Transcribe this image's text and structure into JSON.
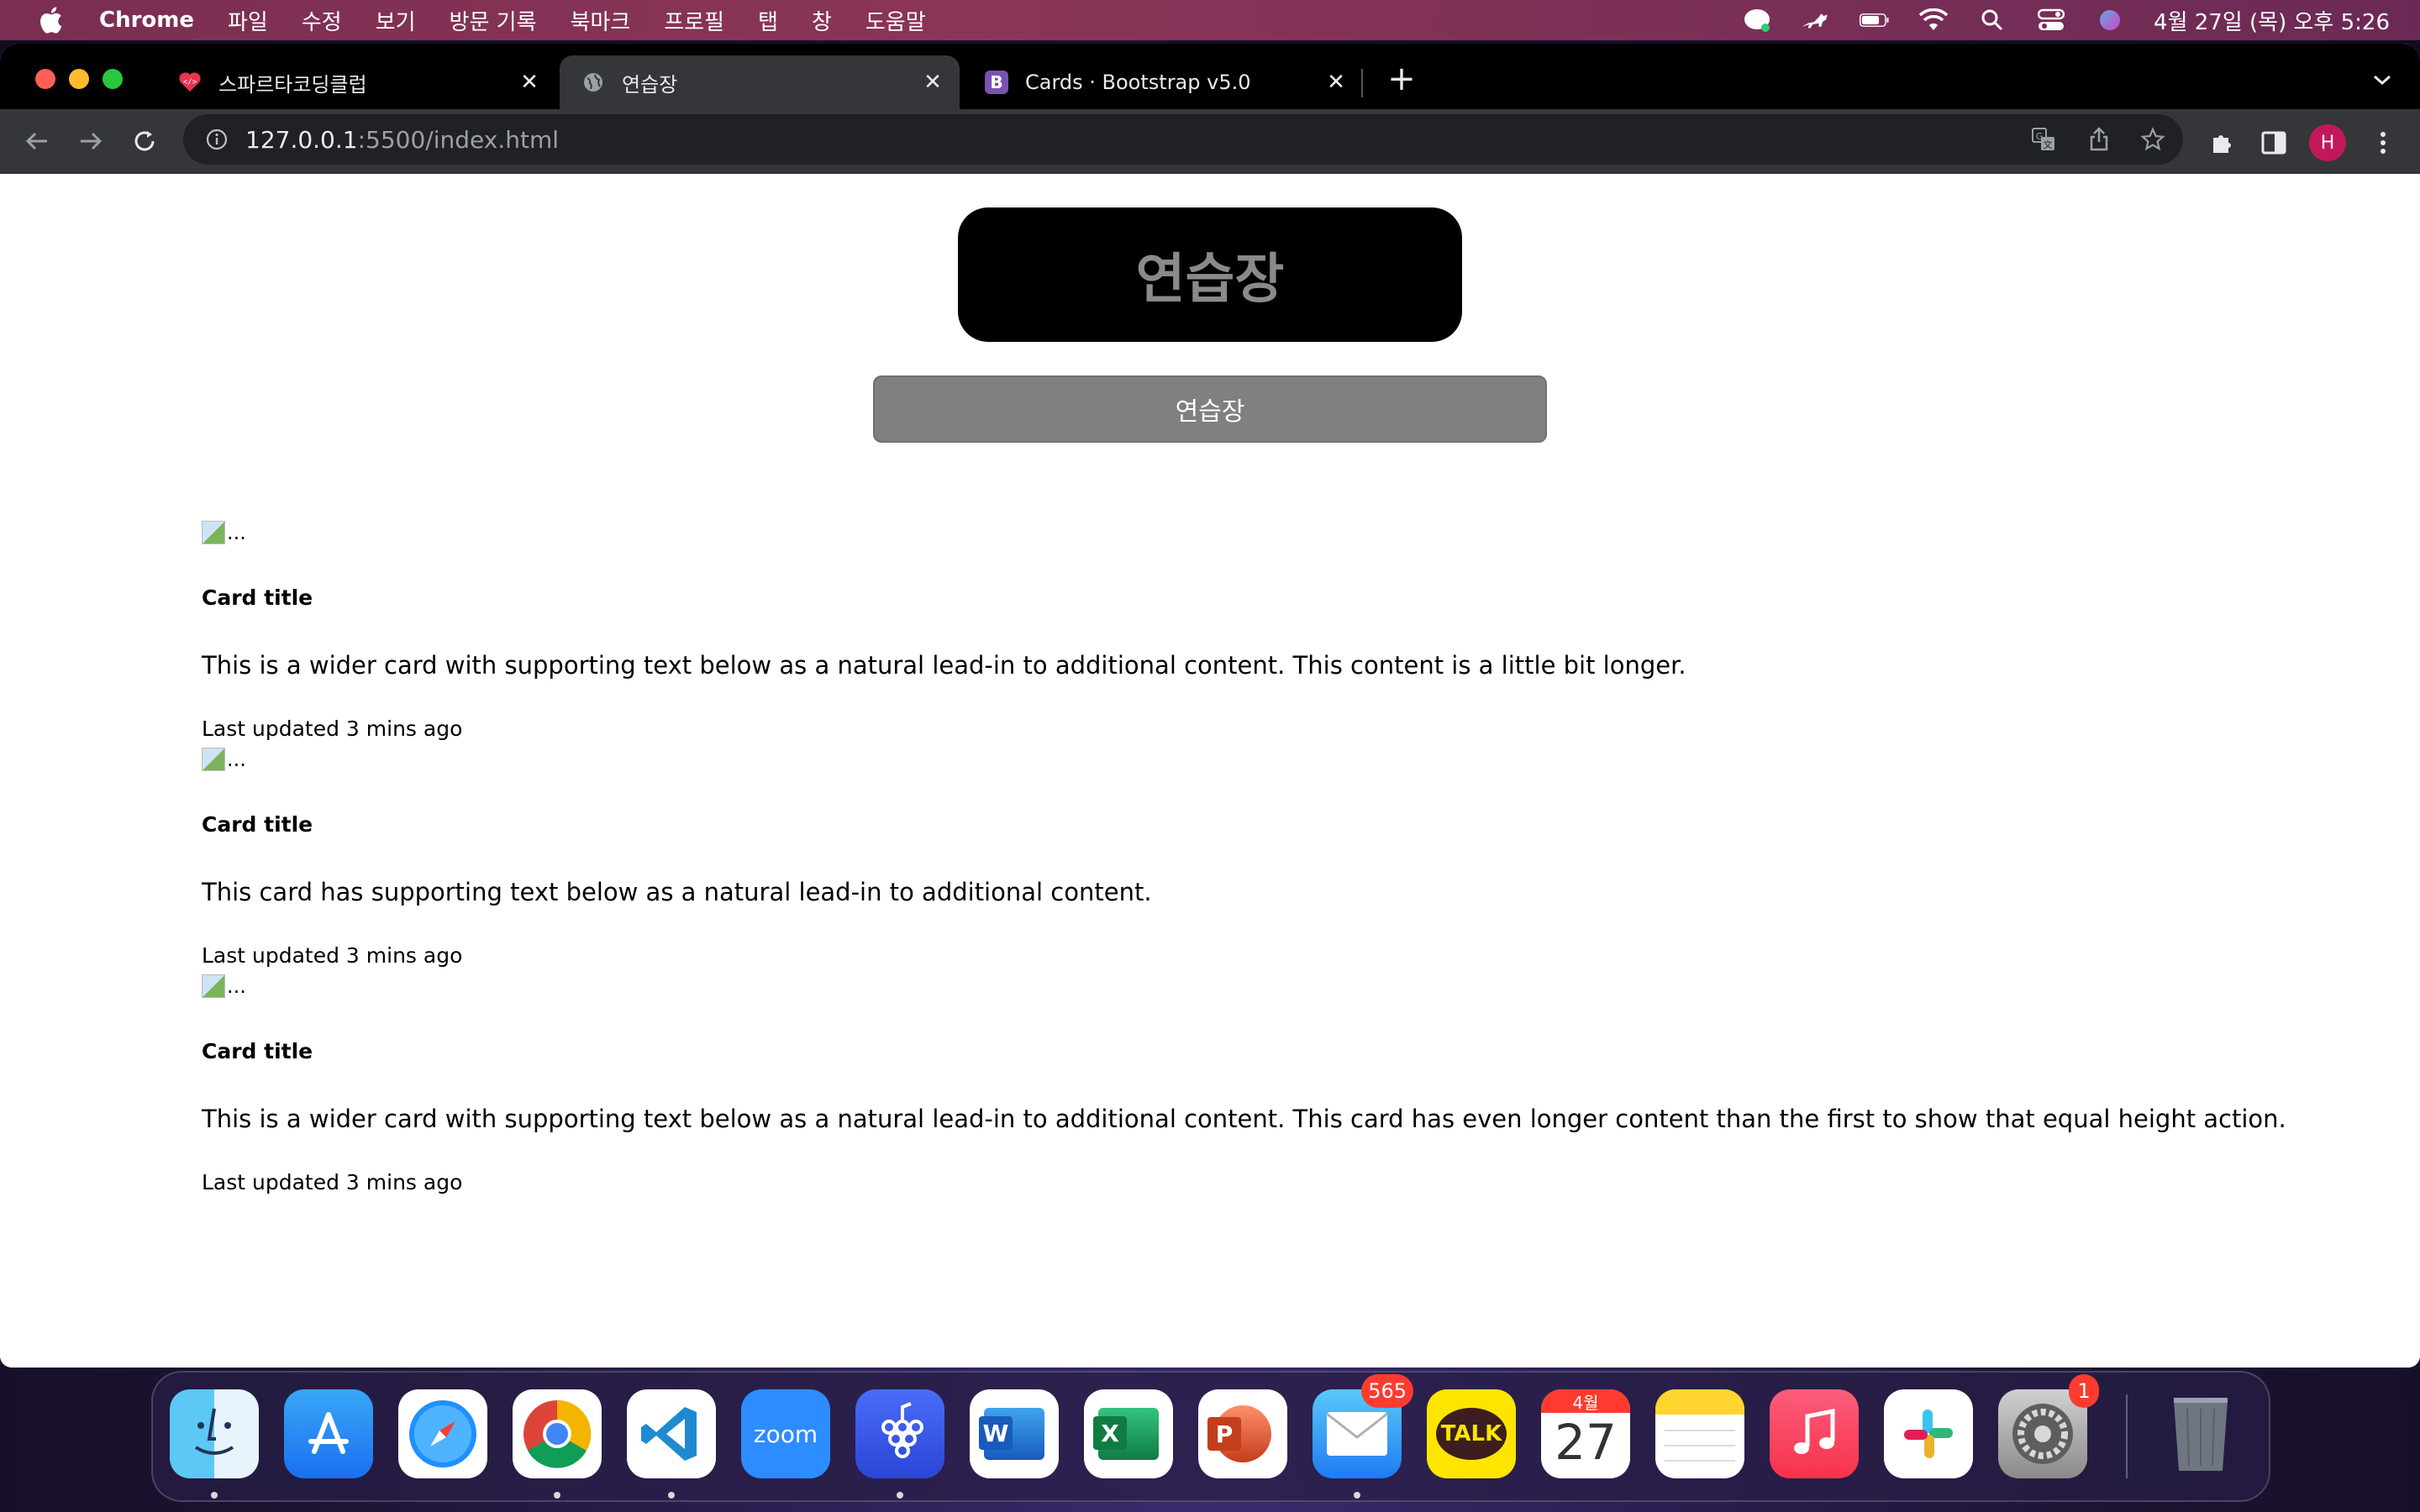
{
  "menubar": {
    "app_name": "Chrome",
    "items": [
      "파일",
      "수정",
      "보기",
      "방문 기록",
      "북마크",
      "프로필",
      "탭",
      "창",
      "도움말"
    ],
    "clock": "4월 27일 (목) 오후 5:26",
    "status_icons": [
      "kakaotalk-status-icon",
      "cat-icon",
      "battery-icon",
      "wifi-icon",
      "spotlight-search-icon",
      "control-center-icon",
      "siri-icon"
    ]
  },
  "tabs": [
    {
      "title": "스파르타코딩클럽",
      "favicon": "heart-code-icon",
      "active": false
    },
    {
      "title": "연습장",
      "favicon": "globe-icon",
      "active": true
    },
    {
      "title": "Cards · Bootstrap v5.0",
      "favicon": "bootstrap-icon",
      "favicon_letter": "B",
      "active": false
    }
  ],
  "toolbar": {
    "url_host": "127.0.0.1",
    "url_path": ":5500/index.html",
    "profile_initial": "H"
  },
  "page": {
    "hero_title": "연습장",
    "button_label": "연습장",
    "cards": [
      {
        "img_alt": "...",
        "title": "Card title",
        "text": "This is a wider card with supporting text below as a natural lead-in to additional content. This content is a little bit longer.",
        "updated": "Last updated 3 mins ago"
      },
      {
        "img_alt": "...",
        "title": "Card title",
        "text": "This card has supporting text below as a natural lead-in to additional content.",
        "updated": "Last updated 3 mins ago"
      },
      {
        "img_alt": "...",
        "title": "Card title",
        "text": "This is a wider card with supporting text below as a natural lead-in to additional content. This card has even longer content than the first to show that equal height action.",
        "updated": "Last updated 3 mins ago"
      }
    ]
  },
  "dock": {
    "apps": [
      {
        "name": "Finder",
        "icon": "finder-icon"
      },
      {
        "name": "App Store",
        "icon": "app-store-icon"
      },
      {
        "name": "Safari",
        "icon": "safari-icon"
      },
      {
        "name": "Chrome",
        "icon": "chrome-icon"
      },
      {
        "name": "Visual Studio Code",
        "icon": "vscode-icon"
      },
      {
        "name": "Zoom",
        "icon": "zoom-icon",
        "label": "zoom"
      },
      {
        "name": "Grape",
        "icon": "grape-icon"
      },
      {
        "name": "Word",
        "icon": "word-icon",
        "letter": "W"
      },
      {
        "name": "Excel",
        "icon": "excel-icon",
        "letter": "X"
      },
      {
        "name": "PowerPoint",
        "icon": "powerpoint-icon",
        "letter": "P"
      },
      {
        "name": "Mail",
        "icon": "mail-icon",
        "badge": "565"
      },
      {
        "name": "KakaoTalk",
        "icon": "kakaotalk-icon",
        "label": "TALK"
      },
      {
        "name": "Calendar",
        "icon": "calendar-icon",
        "month": "4월",
        "day": "27"
      },
      {
        "name": "Notes",
        "icon": "notes-icon"
      },
      {
        "name": "Music",
        "icon": "music-icon"
      },
      {
        "name": "Slack",
        "icon": "slack-icon"
      },
      {
        "name": "System Settings",
        "icon": "settings-icon",
        "badge": "1"
      },
      {
        "name": "Trash",
        "icon": "trash-icon"
      }
    ]
  }
}
